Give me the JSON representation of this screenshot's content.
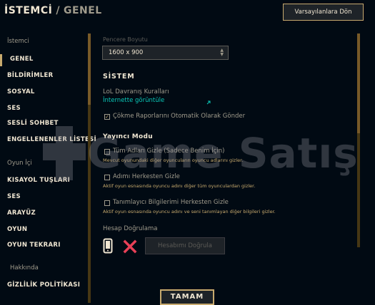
{
  "header": {
    "title": "İSTEMCİ",
    "separator": "/",
    "subtitle": "GENEL",
    "reset_button": "Varsayılanlara Dön"
  },
  "sidebar": {
    "section_client": "İstemci",
    "items_client": [
      {
        "label": "GENEL",
        "active": true
      },
      {
        "label": "BİLDİRİMLER"
      },
      {
        "label": "SOSYAL"
      },
      {
        "label": "SES"
      },
      {
        "label": "SESLİ SOHBET"
      },
      {
        "label": "ENGELLENENLER LİSTESİ"
      }
    ],
    "section_ingame": "Oyun İçi",
    "items_ingame": [
      {
        "label": "KISAYOL TUŞLARI"
      },
      {
        "label": "SES"
      },
      {
        "label": "ARAYÜZ"
      },
      {
        "label": "OYUN"
      },
      {
        "label": "OYUN TEKRARI"
      }
    ],
    "section_about": "Hakkında",
    "items_about": [
      {
        "label": "GİZLİLİK POLİTİKASI"
      }
    ]
  },
  "content": {
    "window_size_label": "Pencere Boyutu",
    "window_size_value": "1600 x 900",
    "system_heading": "SİSTEM",
    "behavior_rules": "LoL Davranış Kuralları",
    "view_online_link": "İnternette görüntüle",
    "crash_report_label": "Çökme Raporlarını Otomatik Olarak Gönder",
    "crash_report_checked": true,
    "streamer_heading": "Yayıncı Modu",
    "hide_names_label": "Tüm Adları Gizle (Sadece Benim İçin)",
    "hide_names_desc": "Mevcut oyunundaki diğer oyuncuların oyuncu adlarını gizler.",
    "hide_names_checked": false,
    "hide_my_name_label": "Adımı Herkesten Gizle",
    "hide_my_name_desc": "Aktif oyun esnasında oyuncu adını diğer tüm oyunculardan gizler.",
    "hide_my_name_checked": false,
    "hide_identity_label": "Tanımlayıcı Bilgilerimi Herkesten Gizle",
    "hide_identity_desc": "Aktif oyun esnasında oyuncu adını ve seni tanımlayan diğer bilgileri gizler.",
    "hide_identity_checked": false,
    "account_verify_label": "Hesap Doğrulama",
    "verify_button": "Hesabımı Doğrula"
  },
  "footer": {
    "ok_button": "TAMAM"
  },
  "watermark": {
    "text": "Game Satış"
  },
  "colors": {
    "background": "#010a13",
    "gold": "#c8aa6e",
    "link": "#0ac8b9",
    "error": "#e84057"
  }
}
